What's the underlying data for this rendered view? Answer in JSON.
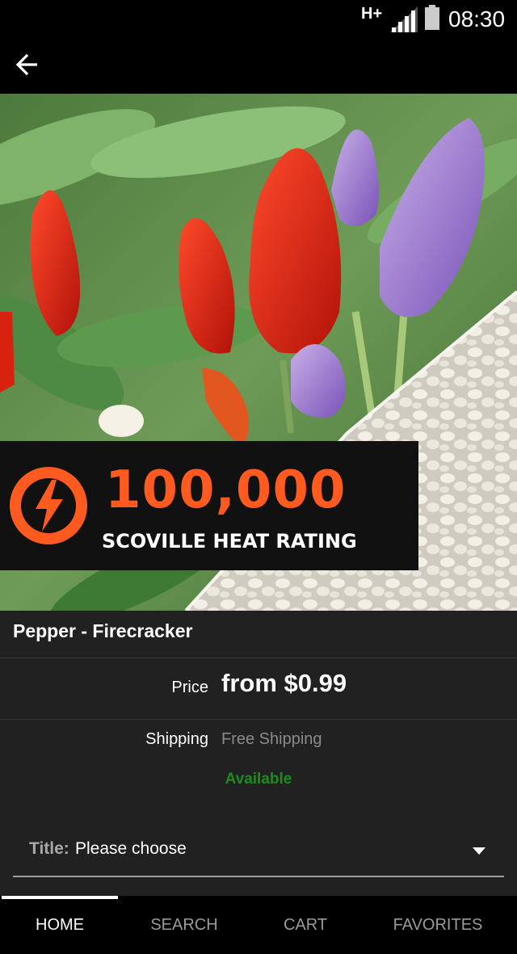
{
  "status_bar": {
    "network": "H+",
    "time": "08:30",
    "icons": [
      "signal-icon",
      "battery-icon"
    ]
  },
  "app_bar": {
    "back_icon": "arrow-left-icon"
  },
  "hero_image": {
    "badge_number": "100,000",
    "badge_text": "SCOVILLE HEAT RATING",
    "badge_icon": "lightning-bolt-icon"
  },
  "product": {
    "title": "Pepper - Firecracker",
    "price_label": "Price",
    "price_value": "from $0.99",
    "shipping_label": "Shipping",
    "shipping_value": "Free Shipping",
    "availability": "Available"
  },
  "option_select": {
    "label": "Title:",
    "value": "Please choose",
    "caret_icon": "dropdown-caret-icon"
  },
  "bottom_nav": {
    "items": [
      {
        "label": "HOME",
        "active": true
      },
      {
        "label": "SEARCH",
        "active": false
      },
      {
        "label": "CART",
        "active": false
      },
      {
        "label": "FAVORITES",
        "active": false
      }
    ]
  },
  "colors": {
    "background": "#212121",
    "bar": "#000000",
    "available_green": "#1f8a1f",
    "badge_orange": "#ff5a1f"
  }
}
